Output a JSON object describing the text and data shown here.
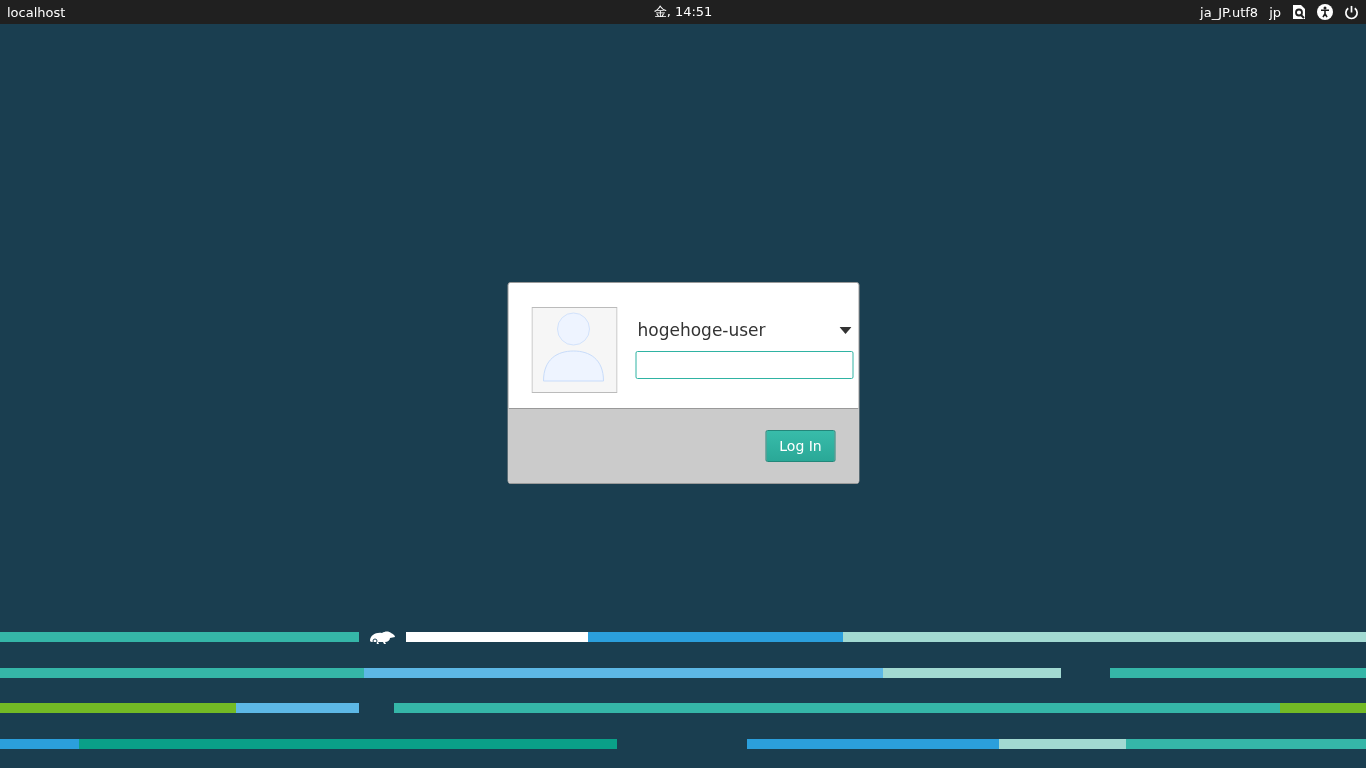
{
  "top_bar": {
    "hostname": "localhost",
    "clock": "金, 14:51",
    "locale": "ja_JP.utf8",
    "keyboard_layout": "jp"
  },
  "login": {
    "user": "hogehoge-user",
    "button": "Log In"
  }
}
